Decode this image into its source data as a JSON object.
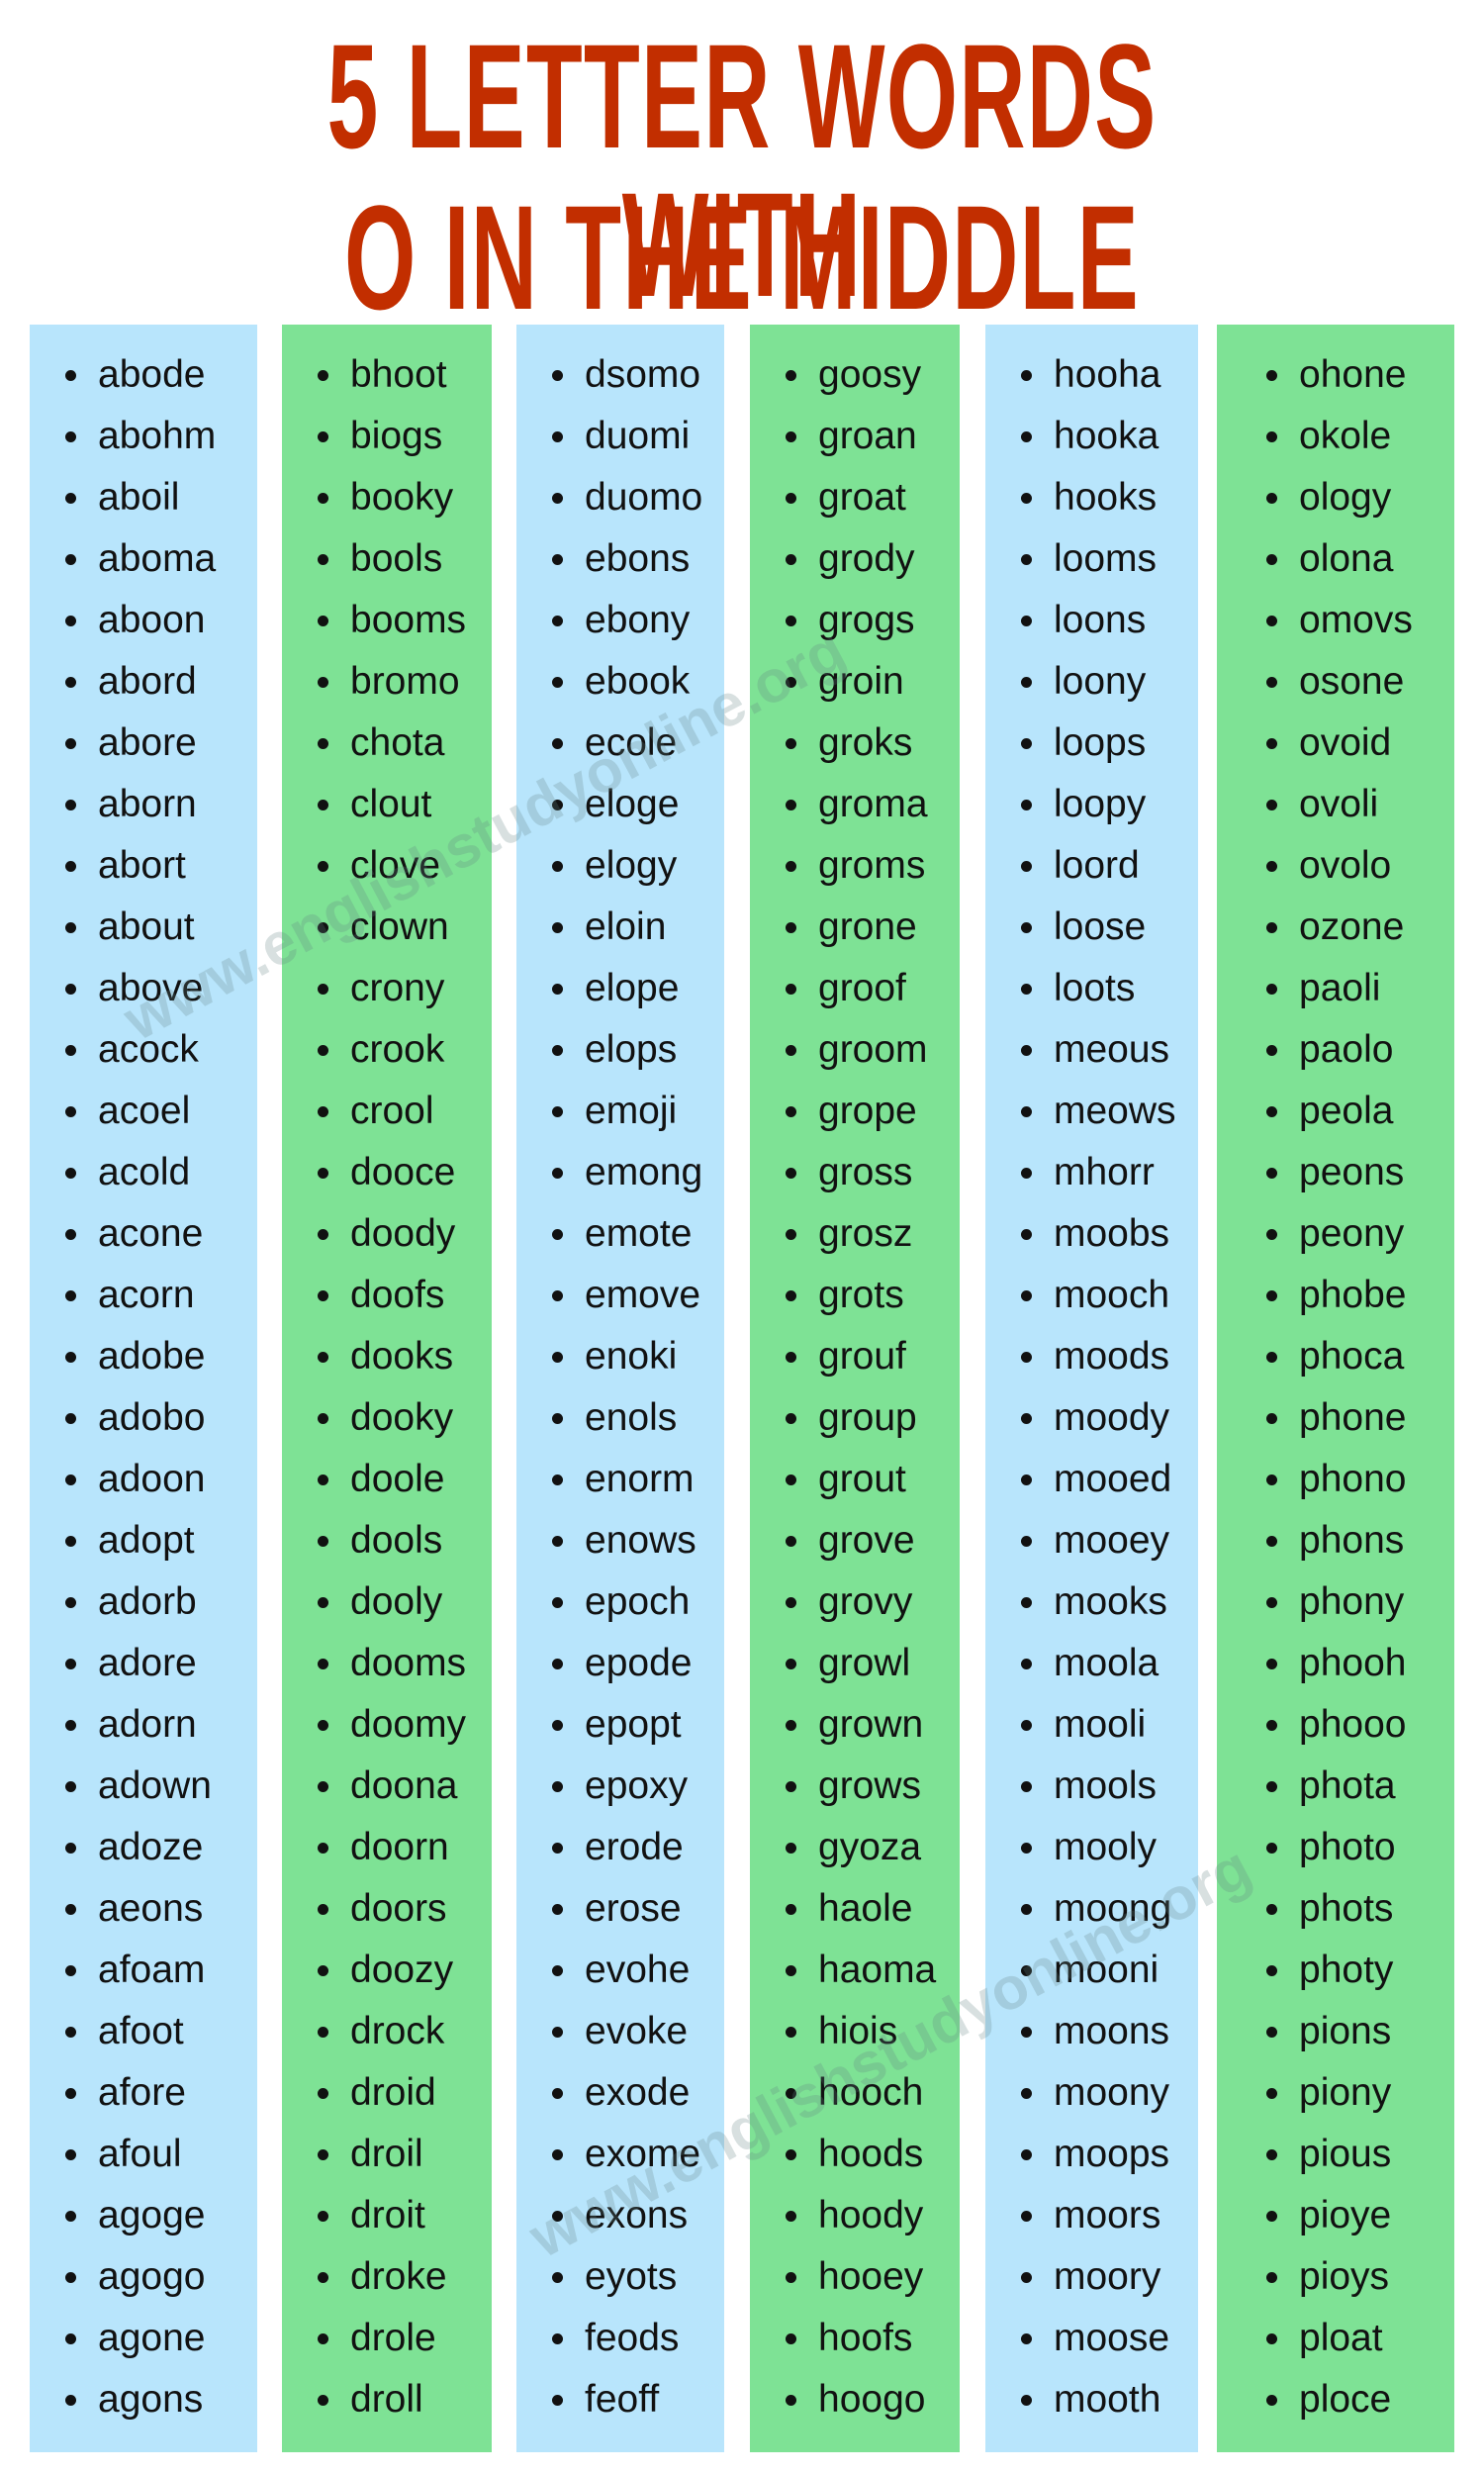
{
  "title": {
    "line1": "5 LETTER WORDS WITH",
    "line2": "O IN THE MIDDLE"
  },
  "colors": {
    "title": "#c22e00",
    "blue_column": "#b8e5fc",
    "green_column": "#7ee295"
  },
  "watermark": "www.englishstudyonline.org",
  "columns": [
    {
      "color": "blue",
      "words": [
        "abode",
        "abohm",
        "aboil",
        "aboma",
        "aboon",
        "abord",
        "abore",
        "aborn",
        "abort",
        "about",
        "above",
        "acock",
        "acoel",
        "acold",
        "acone",
        "acorn",
        "adobe",
        "adobo",
        "adoon",
        "adopt",
        "adorb",
        "adore",
        "adorn",
        "adown",
        "adoze",
        "aeons",
        "afoam",
        "afoot",
        "afore",
        "afoul",
        "agoge",
        "agogo",
        "agone",
        "agons"
      ]
    },
    {
      "color": "green",
      "words": [
        "bhoot",
        "biogs",
        "booky",
        "bools",
        "booms",
        "bromo",
        "chota",
        "clout",
        "clove",
        "clown",
        "crony",
        "crook",
        "crool",
        "dooce",
        "doody",
        "doofs",
        "dooks",
        "dooky",
        "doole",
        "dools",
        "dooly",
        "dooms",
        "doomy",
        "doona",
        "doorn",
        "doors",
        "doozy",
        "drock",
        "droid",
        "droil",
        "droit",
        "droke",
        "drole",
        "droll"
      ]
    },
    {
      "color": "blue",
      "words": [
        "dsomo",
        "duomi",
        "duomo",
        "ebons",
        "ebony",
        "ebook",
        "ecole",
        "eloge",
        "elogy",
        "eloin",
        "elope",
        "elops",
        "emoji",
        "emong",
        "emote",
        "emove",
        "enoki",
        "enols",
        "enorm",
        "enows",
        "epoch",
        "epode",
        "epopt",
        "epoxy",
        "erode",
        "erose",
        "evohe",
        "evoke",
        "exode",
        "exome",
        "exons",
        "eyots",
        "feods",
        "feoff"
      ]
    },
    {
      "color": "green",
      "words": [
        "goosy",
        "groan",
        "groat",
        "grody",
        "grogs",
        "groin",
        "groks",
        "groma",
        "groms",
        "grone",
        "groof",
        "groom",
        "grope",
        "gross",
        "grosz",
        "grots",
        "grouf",
        "group",
        "grout",
        "grove",
        "grovy",
        "growl",
        "grown",
        "grows",
        "gyoza",
        "haole",
        "haoma",
        "hiois",
        "hooch",
        "hoods",
        "hoody",
        "hooey",
        "hoofs",
        "hoogo"
      ]
    },
    {
      "color": "blue",
      "words": [
        "hooha",
        "hooka",
        "hooks",
        "looms",
        "loons",
        "loony",
        "loops",
        "loopy",
        "loord",
        "loose",
        "loots",
        "meous",
        "meows",
        "mhorr",
        "moobs",
        "mooch",
        "moods",
        "moody",
        "mooed",
        "mooey",
        "mooks",
        "moola",
        "mooli",
        "mools",
        "mooly",
        "moong",
        "mooni",
        "moons",
        "moony",
        "moops",
        "moors",
        "moory",
        "moose",
        "mooth"
      ]
    },
    {
      "color": "green",
      "words": [
        "ohone",
        "okole",
        "ology",
        "olona",
        "omovs",
        "osone",
        "ovoid",
        "ovoli",
        "ovolo",
        "ozone",
        "paoli",
        "paolo",
        "peola",
        "peons",
        "peony",
        "phobe",
        "phoca",
        "phone",
        "phono",
        "phons",
        "phony",
        "phooh",
        "phooo",
        "phota",
        "photo",
        "phots",
        "photy",
        "pions",
        "piony",
        "pious",
        "pioye",
        "pioys",
        "ploat",
        "ploce"
      ]
    }
  ]
}
